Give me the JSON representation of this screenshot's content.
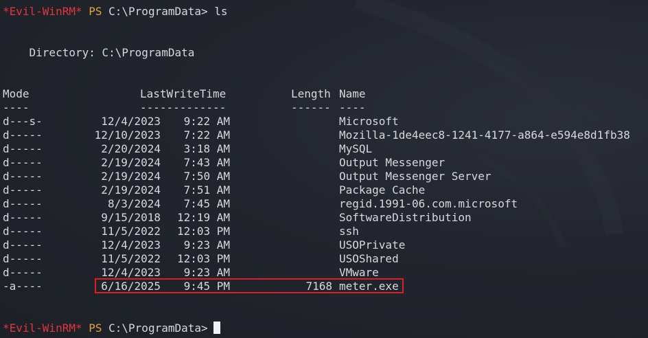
{
  "terminal": {
    "prompt_shell": "*Evil-WinRM*",
    "prompt_ps": "PS",
    "prompt_path": "C:\\ProgramData>",
    "command": "ls",
    "directory_line": "    Directory: C:\\ProgramData",
    "headers": {
      "mode": "Mode",
      "lastwritetime": "LastWriteTime",
      "length": "Length",
      "name": "Name"
    },
    "underlines": {
      "mode": "----",
      "lastwritetime": "-------------",
      "length": "------",
      "name": "----"
    },
    "rows": [
      {
        "mode": "d---s-",
        "date": "12/4/2023",
        "time": "9:22 AM",
        "length": "",
        "name": "Microsoft"
      },
      {
        "mode": "d-----",
        "date": "12/10/2023",
        "time": "7:22 AM",
        "length": "",
        "name": "Mozilla-1de4eec8-1241-4177-a864-e594e8d1fb38"
      },
      {
        "mode": "d-----",
        "date": "2/20/2024",
        "time": "3:18 AM",
        "length": "",
        "name": "MySQL"
      },
      {
        "mode": "d-----",
        "date": "2/19/2024",
        "time": "7:43 AM",
        "length": "",
        "name": "Output Messenger"
      },
      {
        "mode": "d-----",
        "date": "2/19/2024",
        "time": "7:50 AM",
        "length": "",
        "name": "Output Messenger Server"
      },
      {
        "mode": "d-----",
        "date": "2/19/2024",
        "time": "7:51 AM",
        "length": "",
        "name": "Package Cache"
      },
      {
        "mode": "d-----",
        "date": "8/3/2024",
        "time": "7:45 AM",
        "length": "",
        "name": "regid.1991-06.com.microsoft"
      },
      {
        "mode": "d-----",
        "date": "9/15/2018",
        "time": "12:19 AM",
        "length": "",
        "name": "SoftwareDistribution"
      },
      {
        "mode": "d-----",
        "date": "11/5/2022",
        "time": "12:03 PM",
        "length": "",
        "name": "ssh"
      },
      {
        "mode": "d-----",
        "date": "12/4/2023",
        "time": "9:23 AM",
        "length": "",
        "name": "USOPrivate"
      },
      {
        "mode": "d-----",
        "date": "11/5/2022",
        "time": "12:03 PM",
        "length": "",
        "name": "USOShared"
      },
      {
        "mode": "d-----",
        "date": "12/4/2023",
        "time": "9:23 AM",
        "length": "",
        "name": "VMware"
      },
      {
        "mode": "-a----",
        "date": "6/16/2025",
        "time": "9:45 PM",
        "length": "7168",
        "name": "meter.exe"
      }
    ],
    "highlighted_entry": "meter.exe",
    "colors": {
      "background": "#22252d",
      "text": "#d6d9de",
      "prompt_shell": "#e0363f",
      "prompt_ps": "#e7a13c",
      "highlight_border": "#d6202a"
    }
  }
}
